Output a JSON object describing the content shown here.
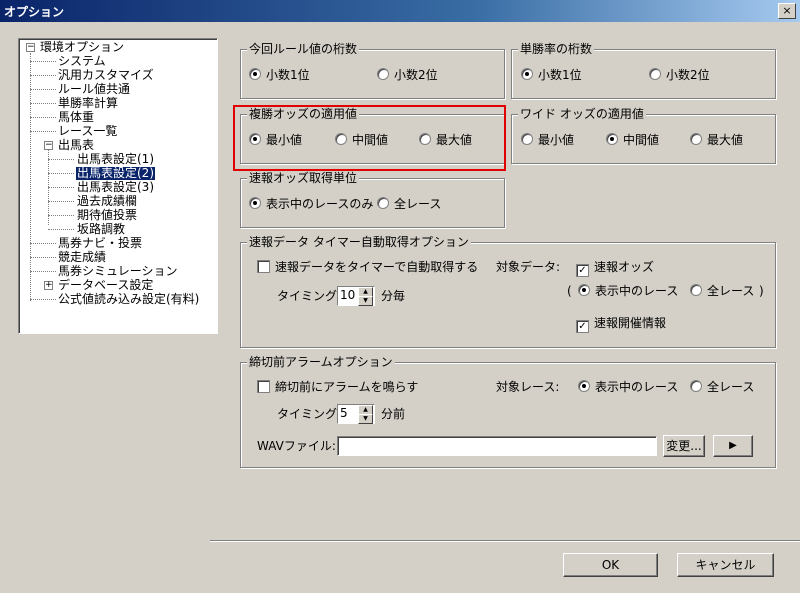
{
  "window": {
    "title": "オプション",
    "close": "×"
  },
  "tree": {
    "items": [
      {
        "label": "環境オプション"
      },
      {
        "label": "システム"
      },
      {
        "label": "汎用カスタマイズ"
      },
      {
        "label": "ルール値共通"
      },
      {
        "label": "単勝率計算"
      },
      {
        "label": "馬体重"
      },
      {
        "label": "レース一覧"
      },
      {
        "label": "出馬表"
      },
      {
        "label": "出馬表設定(1)"
      },
      {
        "label": "出馬表設定(2)"
      },
      {
        "label": "出馬表設定(3)"
      },
      {
        "label": "過去成績欄"
      },
      {
        "label": "期待値投票"
      },
      {
        "label": "坂路調教"
      },
      {
        "label": "馬券ナビ・投票"
      },
      {
        "label": "競走成績"
      },
      {
        "label": "馬券シミュレーション"
      },
      {
        "label": "データベース設定"
      },
      {
        "label": "公式値読み込み設定(有料)"
      }
    ],
    "expander_minus": "−",
    "expander_plus": "+"
  },
  "rule_digits": {
    "legend": "今回ルール値の桁数",
    "opt1": "小数1位",
    "opt2": "小数2位",
    "selected": "小数1位"
  },
  "win_rate_digits": {
    "legend": "単勝率の桁数",
    "opt1": "小数1位",
    "opt2": "小数2位",
    "selected": "小数1位"
  },
  "place_odds": {
    "legend": "複勝オッズの適用値",
    "opt1": "最小値",
    "opt2": "中間値",
    "opt3": "最大値",
    "selected": "最小値"
  },
  "wide_odds": {
    "legend": "ワイド オッズの適用値",
    "opt1": "最小値",
    "opt2": "中間値",
    "opt3": "最大値",
    "selected": "中間値"
  },
  "quick_odds_unit": {
    "legend": "速報オッズ取得単位",
    "opt1": "表示中のレースのみ",
    "opt2": "全レース",
    "selected": "表示中のレースのみ"
  },
  "quick_timer": {
    "legend": "速報データ タイマー自動取得オプション",
    "auto_fetch": "速報データをタイマーで自動取得する",
    "target_label": "対象データ:",
    "odds_check": "速報オッズ",
    "paren_open": "(",
    "paren_close": ")",
    "race_opt1": "表示中のレース",
    "race_opt2": "全レース",
    "meeting_check": "速報開催情報",
    "timing_label": "タイミング:",
    "timing_value": "10",
    "timing_unit": "分毎"
  },
  "alarm": {
    "legend": "締切前アラームオプション",
    "alarm_check": "締切前にアラームを鳴らす",
    "target_label": "対象レース:",
    "race_opt1": "表示中のレース",
    "race_opt2": "全レース",
    "timing_label": "タイミング:",
    "timing_value": "5",
    "timing_unit": "分前",
    "wav_label": "WAVファイル:",
    "wav_value": "",
    "change_button": "変更...",
    "play_button": "▶"
  },
  "footer": {
    "ok": "OK",
    "cancel": "キャンセル"
  },
  "colors": {
    "dialog_bg": "#d4d0c8",
    "titlebar": "#0a246a",
    "highlight": "#e00000",
    "selection": "#0a246a"
  }
}
